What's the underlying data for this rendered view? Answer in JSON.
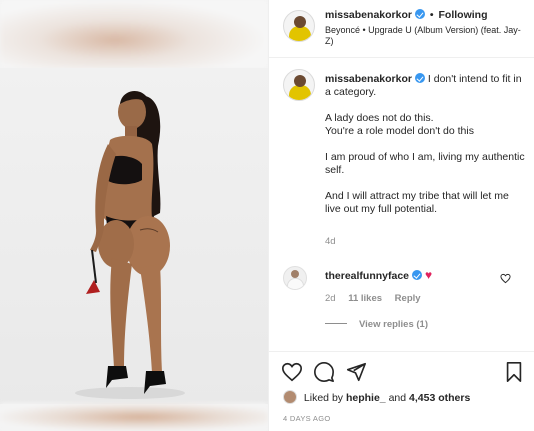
{
  "post": {
    "username": "missabenakorkor",
    "following_label": "Following",
    "song": "Beyoncé • Upgrade U (Album Version) (feat. Jay-Z)"
  },
  "caption": {
    "username": "missabenakorkor",
    "line1": "I don't intend to fit in a category.",
    "line2a": "A lady does not do this.",
    "line2b": "You're a role model don't do this",
    "line3": "I am proud of who I am, living my authentic self.",
    "line4": "And I will attract my tribe that will let me live out my full potential.",
    "age": "4d"
  },
  "comment": {
    "username": "therealfunnyface",
    "age": "2d",
    "likes": "11 likes",
    "reply_label": "Reply",
    "view_replies": "View replies (1)"
  },
  "likes": {
    "prefix": "Liked by",
    "liker": "hephie_",
    "connector": "and",
    "others": "4,453 others"
  },
  "timestamp": "4 DAYS AGO",
  "icons": {
    "like": "heart-outline-icon",
    "comment": "comment-bubble-icon",
    "share": "paper-plane-icon",
    "save": "bookmark-icon",
    "verified": "verified-badge-icon"
  },
  "colors": {
    "verified": "#3897f0",
    "heart": "#e0245e",
    "muted": "#8e8e8e"
  }
}
